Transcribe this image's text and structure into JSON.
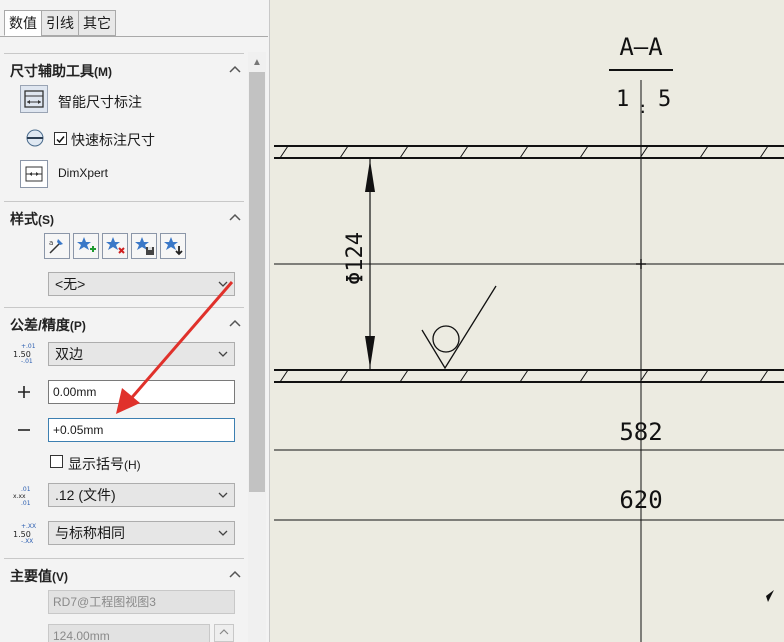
{
  "tabs": [
    "数值",
    "引线",
    "其它"
  ],
  "sections": {
    "dim_tools": {
      "title": "尺寸辅助工具",
      "hotkey": "(M)",
      "smart_dim": "智能尺寸标注",
      "quick_dim": "快速标注尺寸",
      "quick_dim_checked": true,
      "dimxpert": "DimXpert"
    },
    "style": {
      "title": "样式",
      "hotkey": "(S)",
      "style_select": "<无>"
    },
    "tolerance": {
      "title": "公差/精度",
      "hotkey": "(P)",
      "tol_type": "双边",
      "tol_type_icon_text": "1.50",
      "plus_value": "0.00mm",
      "minus_value": "+0.05mm",
      "show_paren": "显示括号",
      "show_paren_hotkey": "(H)",
      "show_paren_checked": false,
      "precision": ".12 (文件)",
      "tol_precision": "与标称相同"
    },
    "primary": {
      "title": "主要值",
      "hotkey": "(V)",
      "name_value": "RD7@工程图视图3",
      "dim_value": "124.00mm"
    }
  },
  "drawing": {
    "section_label": "A—A",
    "scale_left": "1",
    "scale_colon": ":",
    "scale_right": "5",
    "dim_diameter": "Φ124",
    "dim_582": "582",
    "dim_620": "620"
  },
  "colors": {
    "drawing_bg": "#ecebe1",
    "panel_bg": "#f3f3f3",
    "annotation_arrow": "#e0312b",
    "focus_border": "#3c7fb1"
  }
}
